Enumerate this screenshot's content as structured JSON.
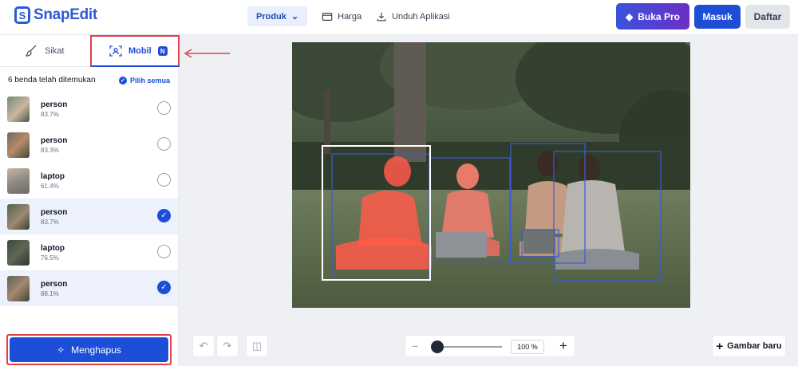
{
  "header": {
    "logo_text": "SnapEdit",
    "nav": {
      "product": "Produk",
      "pricing": "Harga",
      "download": "Unduh Aplikasi"
    },
    "buttons": {
      "pro": "Buka Pro",
      "login": "Masuk",
      "register": "Daftar"
    }
  },
  "panel": {
    "tabs": {
      "brush": "Sikat",
      "mobile": "Mobil",
      "mobile_badge": "N"
    },
    "found_text": "6 benda telah ditemukan",
    "select_all": "Pilih semua",
    "items": [
      {
        "label": "person",
        "score": "83.7%",
        "checked": false
      },
      {
        "label": "person",
        "score": "83.3%",
        "checked": false
      },
      {
        "label": "laptop",
        "score": "61.4%",
        "checked": false
      },
      {
        "label": "person",
        "score": "83.7%",
        "checked": true
      },
      {
        "label": "laptop",
        "score": "76.5%",
        "checked": false
      },
      {
        "label": "person",
        "score": "88.1%",
        "checked": true
      }
    ],
    "erase_button": "Menghapus"
  },
  "toolbar": {
    "zoom_value": "100 %",
    "zoom_level": 0.05,
    "new_image": "Gambar baru"
  },
  "colors": {
    "brand": "#2d5bd6",
    "primary": "#1d4ed8",
    "highlight_box": "#e0404a",
    "mask": "#ff5a4a"
  }
}
